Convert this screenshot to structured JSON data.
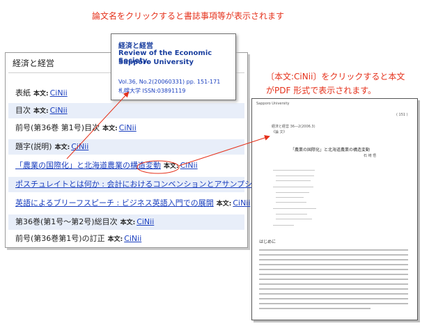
{
  "captions": {
    "top": "論文名をクリックすると書誌事項等が表示されます",
    "right": "〔本文:CiNii〕をクリックすると本文がPDF 形式で表示されます。"
  },
  "list": {
    "title": "経済と経営",
    "honbun_label": "本文:",
    "cinii_label": "CiNii",
    "items": [
      {
        "title": "表紙"
      },
      {
        "title": "目次"
      },
      {
        "title": "前号(第36巻 第1号)目次"
      },
      {
        "title": "題字(説明)"
      },
      {
        "title": "「農業の国際化」と北海道農業の構造変動"
      },
      {
        "title": "ポスチュレイトとは何か : 会計におけるコンベンションとアサンプション"
      },
      {
        "title": "英語によるブリーフスピーチ : ビジネス英語入門での展開"
      },
      {
        "title": "第36巻(第1号〜第2号)総目次"
      },
      {
        "title": "前号(第36巻第1号)の訂正"
      }
    ]
  },
  "bib_popup": {
    "title_jp": "経済と経営",
    "title_en_1": "Review of the Economic Society,",
    "title_en_2": "Sapporo University",
    "volume": "Vol.36, No.2(20060331) pp. 151-171",
    "publisher": "札幌大学 ISSN:03891119"
  },
  "pdf": {
    "header_left": "Sapporo University",
    "page_no": "( 151 )",
    "journal_line_1": "経済と経営 36―2(2006.3)",
    "journal_line_2": "《論 文》",
    "heading": "「農業の国際化」と北海道農業の構造変動",
    "author": "石 崎 悟",
    "section": "はじめに"
  },
  "colors": {
    "caption": "#e5311b",
    "link": "#1a3fbf",
    "row_highlight": "#e8eef9",
    "arrow": "#e5311b"
  }
}
